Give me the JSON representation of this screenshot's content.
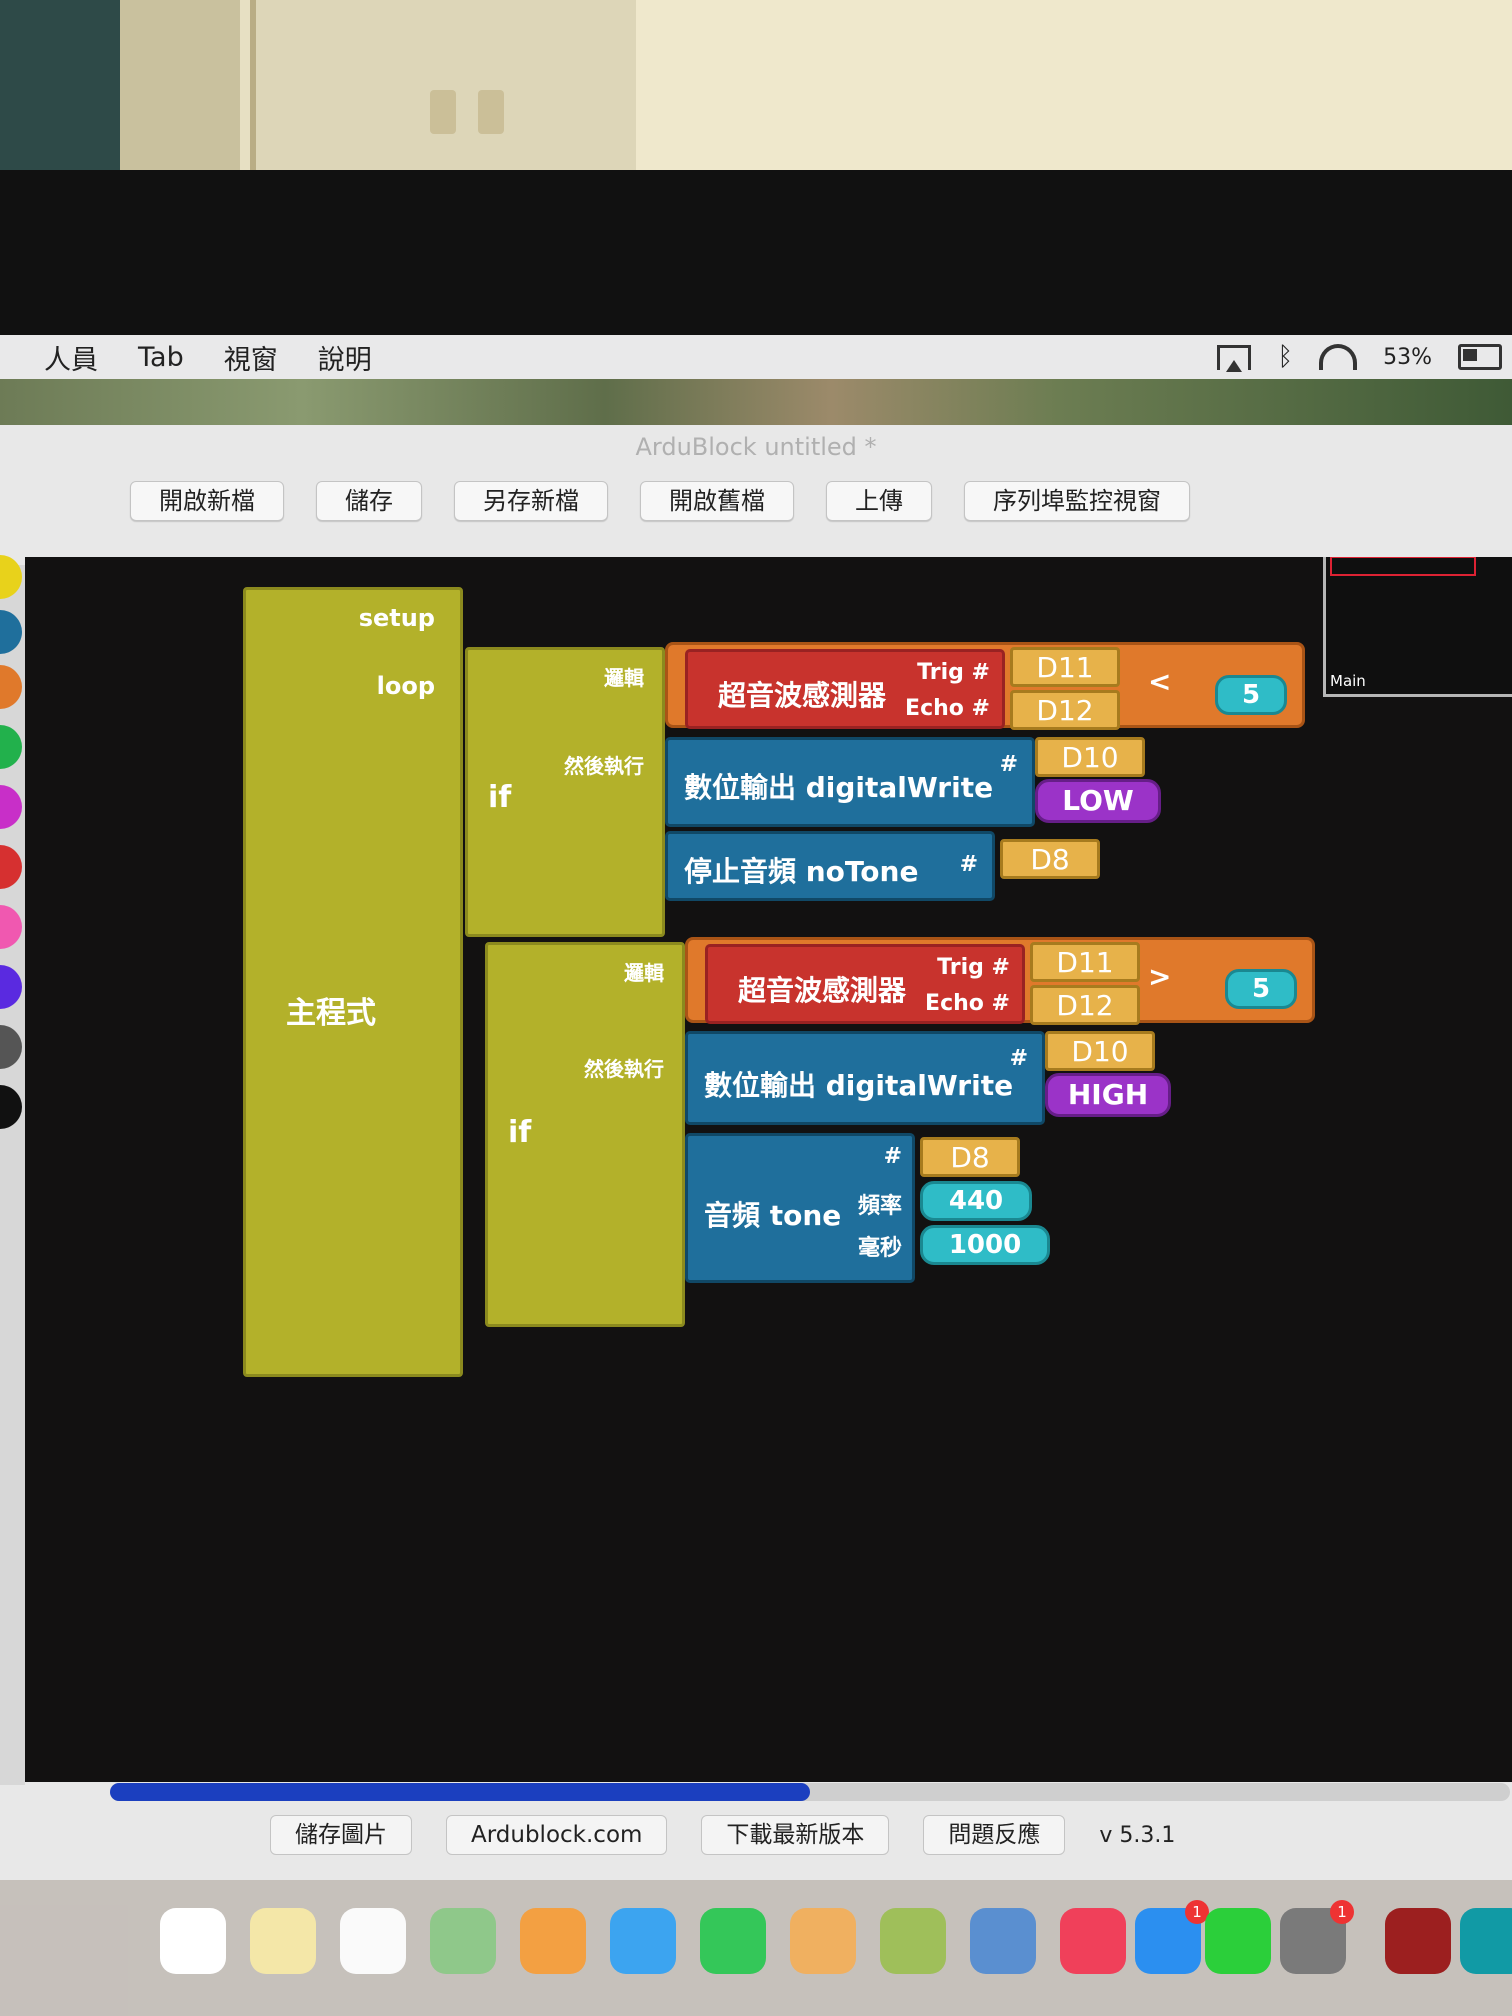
{
  "menu": {
    "items": [
      "人員",
      "Tab",
      "視窗",
      "說明"
    ]
  },
  "status": {
    "battery": "53%"
  },
  "window": {
    "title": "ArduBlock untitled *"
  },
  "toolbar": {
    "buttons": [
      "開啟新檔",
      "儲存",
      "另存新檔",
      "開啟舊檔",
      "上傳",
      "序列埠監控視窗"
    ]
  },
  "minimap": {
    "label": "Main"
  },
  "program": {
    "main_label": "主程式",
    "setup_label": "setup",
    "loop_label": "loop",
    "if_label": "if",
    "logic_label": "邏輯",
    "then_label": "然後執行",
    "if1": {
      "sensor": "超音波感測器",
      "trig": "Trig #",
      "echo": "Echo #",
      "trig_pin": "D11",
      "echo_pin": "D12",
      "op": "<",
      "value": "5",
      "cmd1": "數位輸出 digitalWrite",
      "cmd1_hash": "#",
      "cmd1_pin": "D10",
      "cmd1_state": "LOW",
      "cmd2": "停止音頻 noTone",
      "cmd2_hash": "#",
      "cmd2_pin": "D8"
    },
    "if2": {
      "sensor": "超音波感測器",
      "trig": "Trig #",
      "echo": "Echo #",
      "trig_pin": "D11",
      "echo_pin": "D12",
      "op": ">",
      "value": "5",
      "cmd1": "數位輸出 digitalWrite",
      "cmd1_hash": "#",
      "cmd1_pin": "D10",
      "cmd1_state": "HIGH",
      "cmd2": "音頻 tone",
      "cmd2_hash": "#",
      "cmd2_pin": "D8",
      "freq_label": "頻率",
      "freq": "440",
      "ms_label": "毫秒",
      "ms": "1000"
    }
  },
  "bottom": {
    "buttons": [
      "儲存圖片",
      "Ardublock.com",
      "下載最新版本",
      "問題反應"
    ],
    "version": "v 5.3.1"
  },
  "colors": {
    "canvas": "#121111",
    "main": "#b3b12a",
    "sensor": "#c8332d",
    "compare": "#e0792b",
    "command": "#1f6f9c",
    "pin": "#e7b24a",
    "number": "#2fbcc7",
    "state": "#9b33c8"
  }
}
